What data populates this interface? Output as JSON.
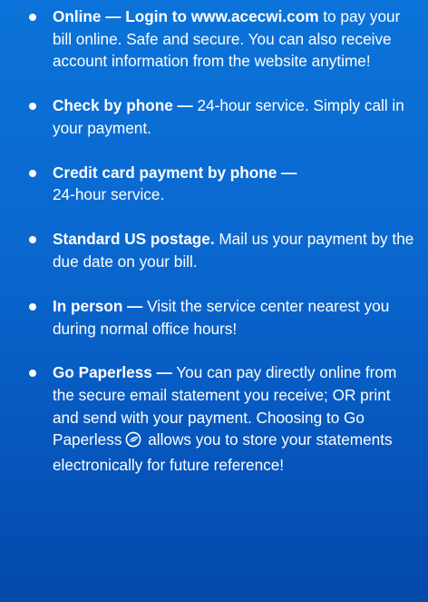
{
  "payment_options": [
    {
      "lead": "Online —  Login to www.acecwi.com",
      "text": " to pay your bill online.  Safe and secure. You can also receive account information from the website anytime!"
    },
    {
      "lead": "Check by phone —",
      "text": " 24-hour service. Simply call in your payment."
    },
    {
      "lead": "Credit card payment by phone —",
      "text": " 24-hour service."
    },
    {
      "lead": "Standard US postage.",
      "text": "  Mail us your payment by the due date on your bill."
    },
    {
      "lead": "In person —",
      "text": "  Visit the service center nearest you during normal office hours!"
    },
    {
      "lead": "Go Paperless —",
      "text": "  You can pay directly online from the secure email statement you receive; OR print and send with your payment.  Choosing to Go Paperless",
      "icon": "leaf-circle-icon",
      "text_after_icon": " allows you to store your statements electronically for future reference!"
    }
  ],
  "colors": {
    "background_top": "#0b73d9",
    "background_bottom": "#0449a9",
    "text": "#ffffff"
  }
}
